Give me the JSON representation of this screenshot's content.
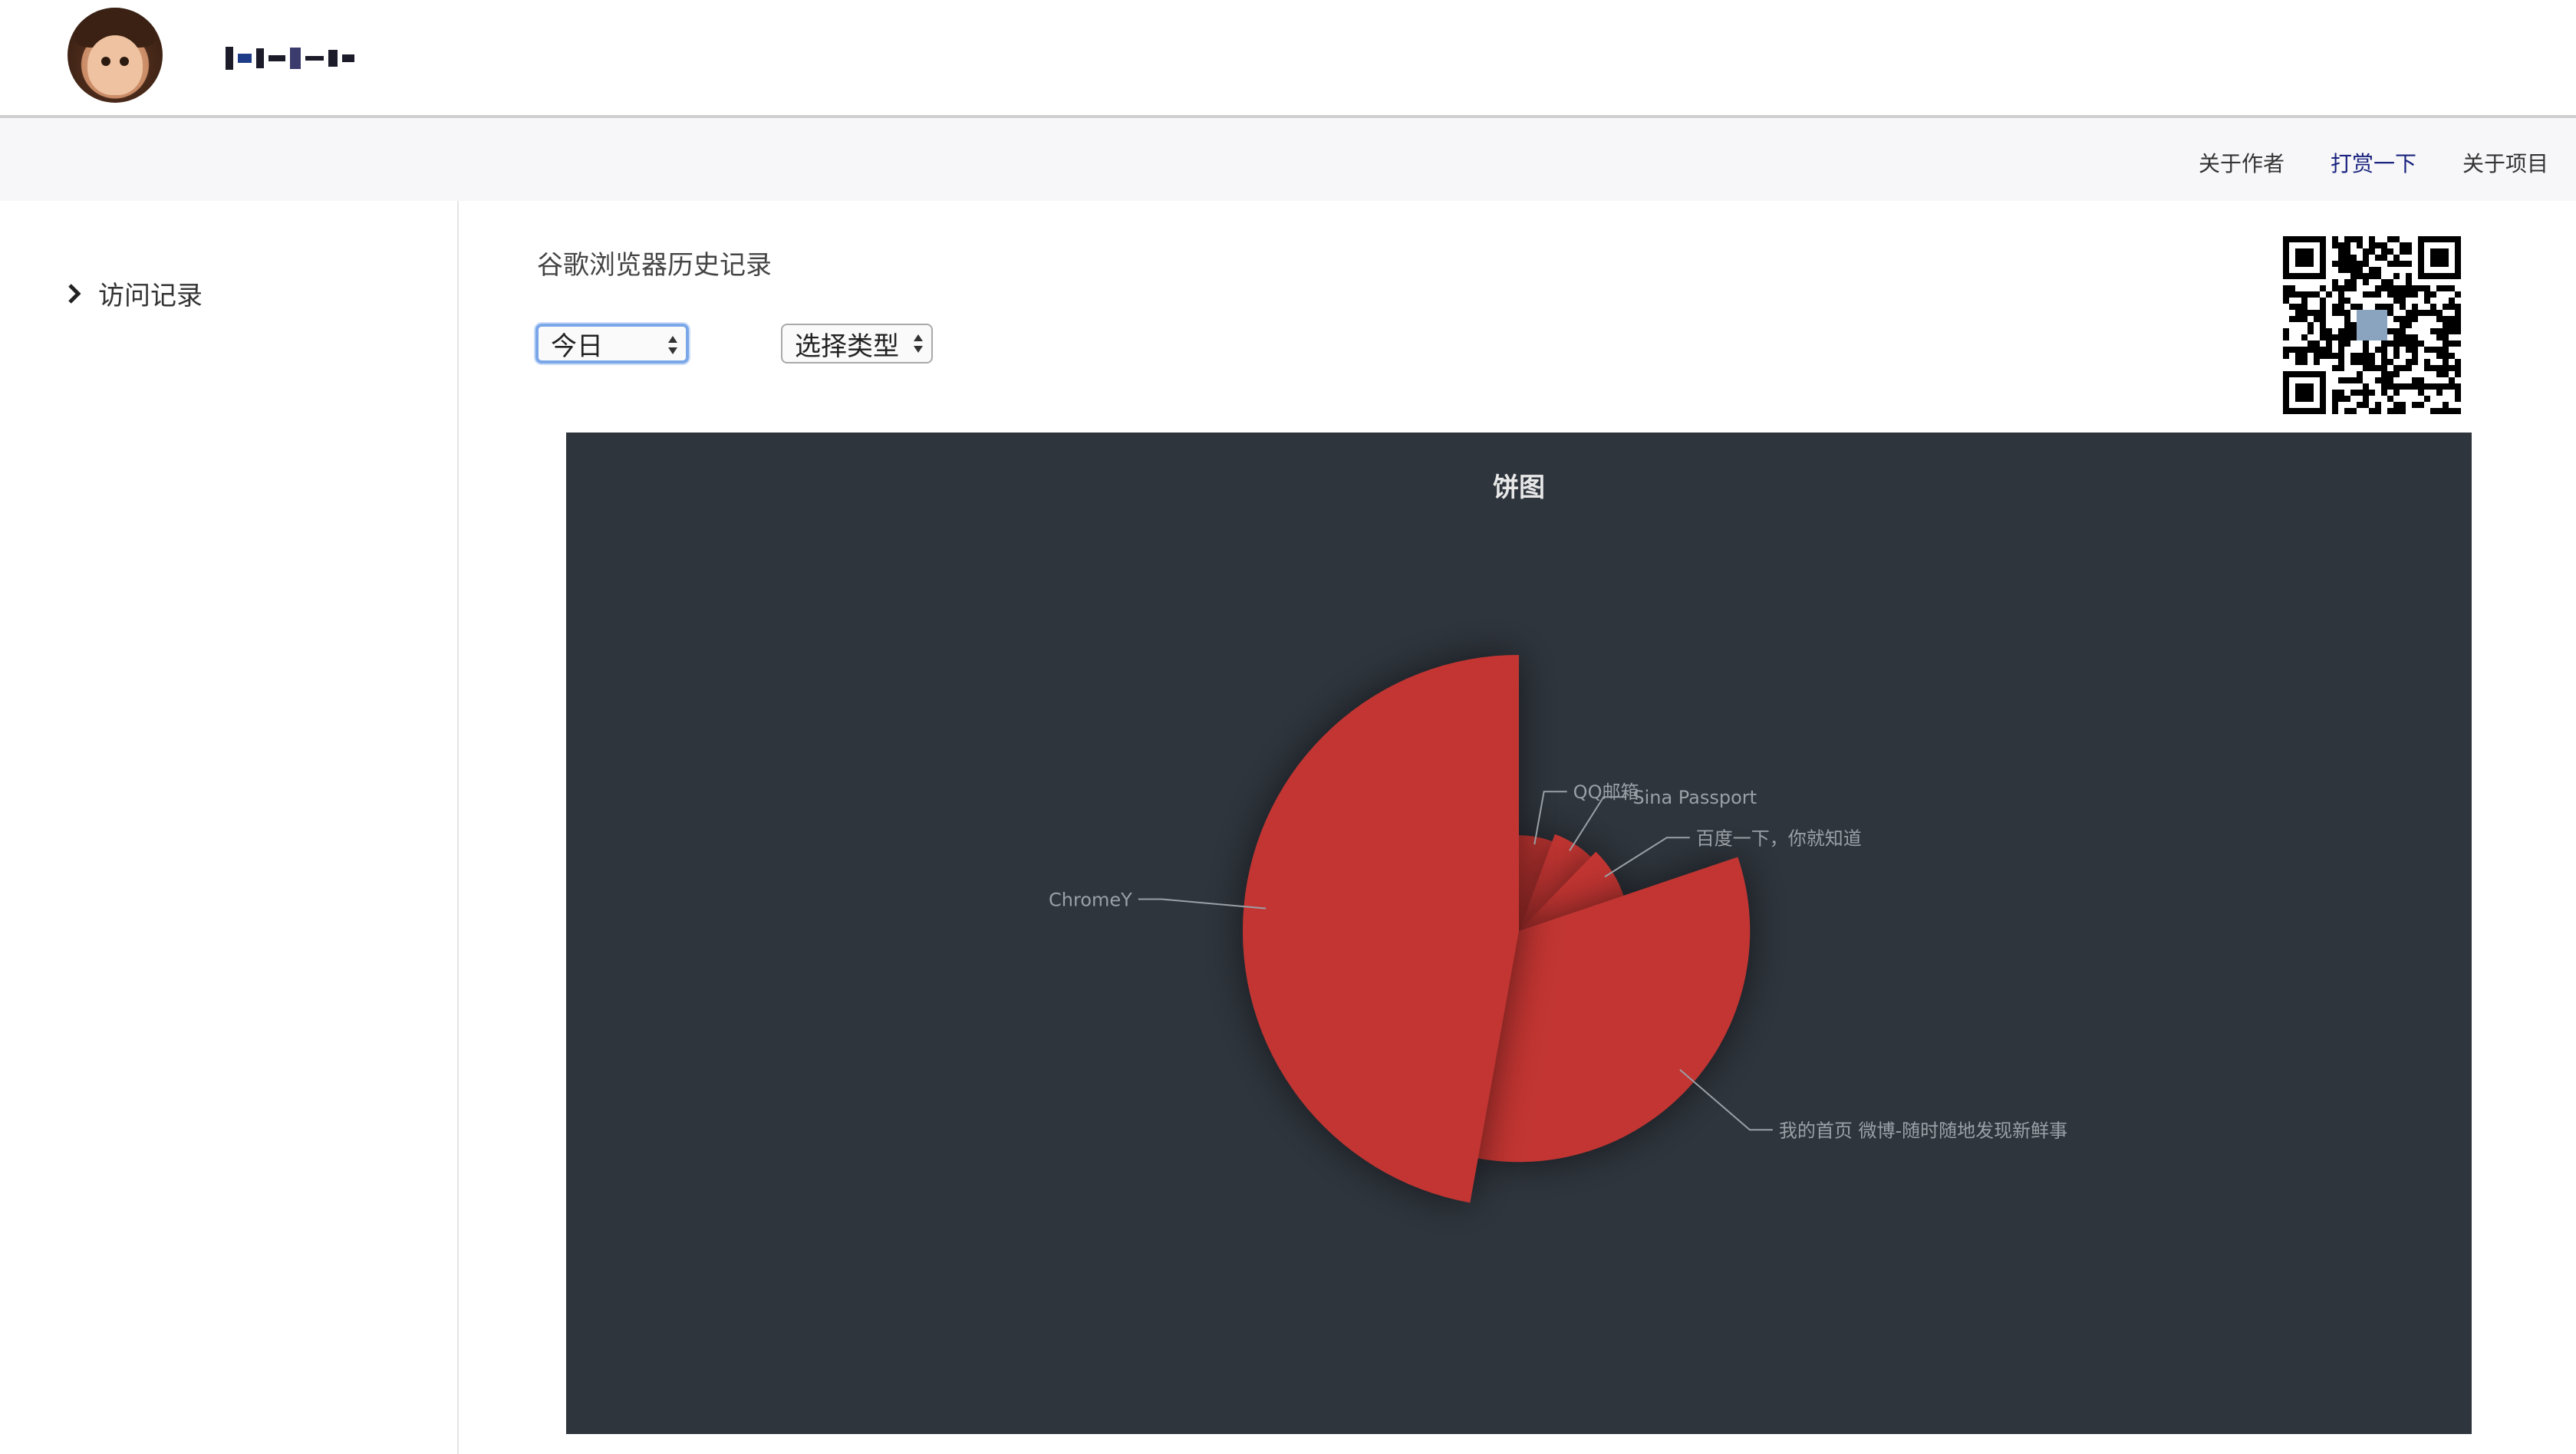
{
  "header": {
    "avatar_alt": "avatar",
    "logo_text": ""
  },
  "nav": {
    "items": [
      {
        "label": "关于作者"
      },
      {
        "label": "打赏一下"
      },
      {
        "label": "关于项目"
      }
    ]
  },
  "sidebar": {
    "items": [
      {
        "label": "访问记录"
      }
    ]
  },
  "main": {
    "title": "谷歌浏览器历史记录",
    "date_select": {
      "value": "今日"
    },
    "type_select": {
      "value": "选择类型"
    }
  },
  "colors": {
    "chart_bg": "#2f353d",
    "slice": "#c23531",
    "label": "#9aa0a6",
    "nav_active": "#1a237e"
  },
  "chart_data": {
    "type": "pie",
    "title": "饼图",
    "rose_type": "radius",
    "slices": [
      {
        "name": "ChromeY",
        "value": 100
      },
      {
        "name": "我的首页 微博-随时随地发现新鲜事",
        "value": 70
      },
      {
        "name": "百度一下，你就知道",
        "value": 16
      },
      {
        "name": "Sina Passport",
        "value": 14
      },
      {
        "name": "QQ邮箱",
        "value": 12
      }
    ]
  }
}
